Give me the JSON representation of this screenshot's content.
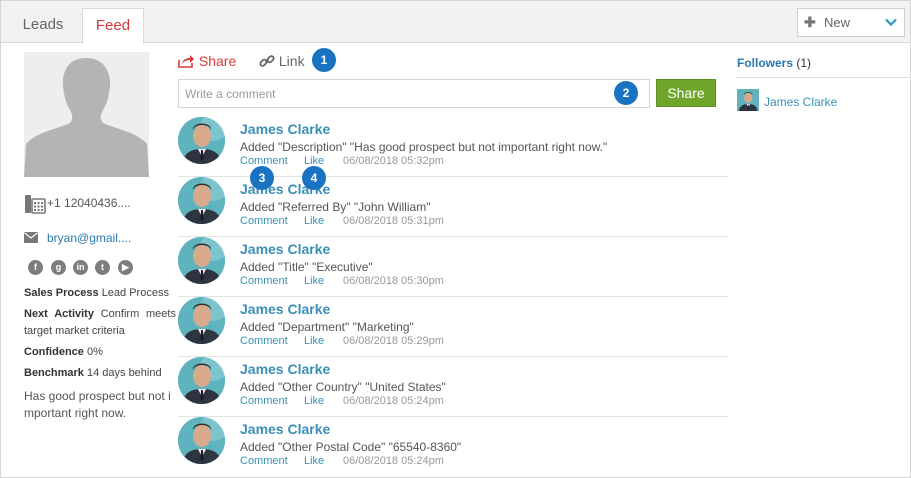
{
  "tabs": [
    {
      "label": "Leads"
    },
    {
      "label": "Feed"
    }
  ],
  "new_button": {
    "label": "New"
  },
  "profile": {
    "phone": "+1 12040436....",
    "email": "bryan@gmail....",
    "sales_process_label": "Sales Process",
    "sales_process_value": "Lead Process",
    "next_activity_label": "Next Activity",
    "next_activity_value": "Confirm meets target market criteria",
    "confidence_label": "Confidence",
    "confidence_value": "0%",
    "benchmark_label": "Benchmark",
    "benchmark_value": "14 days behind",
    "description": "Has good prospect but not important right now."
  },
  "social_icons": [
    "facebook-icon",
    "google-plus-icon",
    "linkedin-icon",
    "twitter-icon",
    "youtube-icon"
  ],
  "composer": {
    "share_tab": "Share",
    "link_tab": "Link",
    "placeholder": "Write a comment",
    "share_button": "Share"
  },
  "badges": [
    "1",
    "2",
    "3",
    "4"
  ],
  "feed": [
    {
      "name": "James Clarke",
      "text": "Added \"Description\" \"Has good prospect but not important right now.\"",
      "comment": "Comment",
      "like": "Like",
      "time": "06/08/2018 05:32pm"
    },
    {
      "name": "James Clarke",
      "text": "Added \"Referred By\" \"John William\"",
      "comment": "Comment",
      "like": "Like",
      "time": "06/08/2018 05:31pm"
    },
    {
      "name": "James Clarke",
      "text": "Added \"Title\" \"Executive\"",
      "comment": "Comment",
      "like": "Like",
      "time": "06/08/2018 05:30pm"
    },
    {
      "name": "James Clarke",
      "text": "Added \"Department\" \"Marketing\"",
      "comment": "Comment",
      "like": "Like",
      "time": "06/08/2018 05:29pm"
    },
    {
      "name": "James Clarke",
      "text": "Added \"Other Country\" \"United States\"",
      "comment": "Comment",
      "like": "Like",
      "time": "06/08/2018 05:24pm"
    },
    {
      "name": "James Clarke",
      "text": "Added \"Other Postal Code\" \"65540-8360\"",
      "comment": "Comment",
      "like": "Like",
      "time": "06/08/2018 05:24pm"
    }
  ],
  "followers": {
    "title": "Followers",
    "count": "(1)",
    "items": [
      {
        "name": "James Clarke"
      }
    ]
  },
  "colors": {
    "accent_red": "#d9383a",
    "link_blue": "#3a8fb7",
    "share_green": "#6fa52b",
    "badge_blue": "#1a73c2"
  }
}
